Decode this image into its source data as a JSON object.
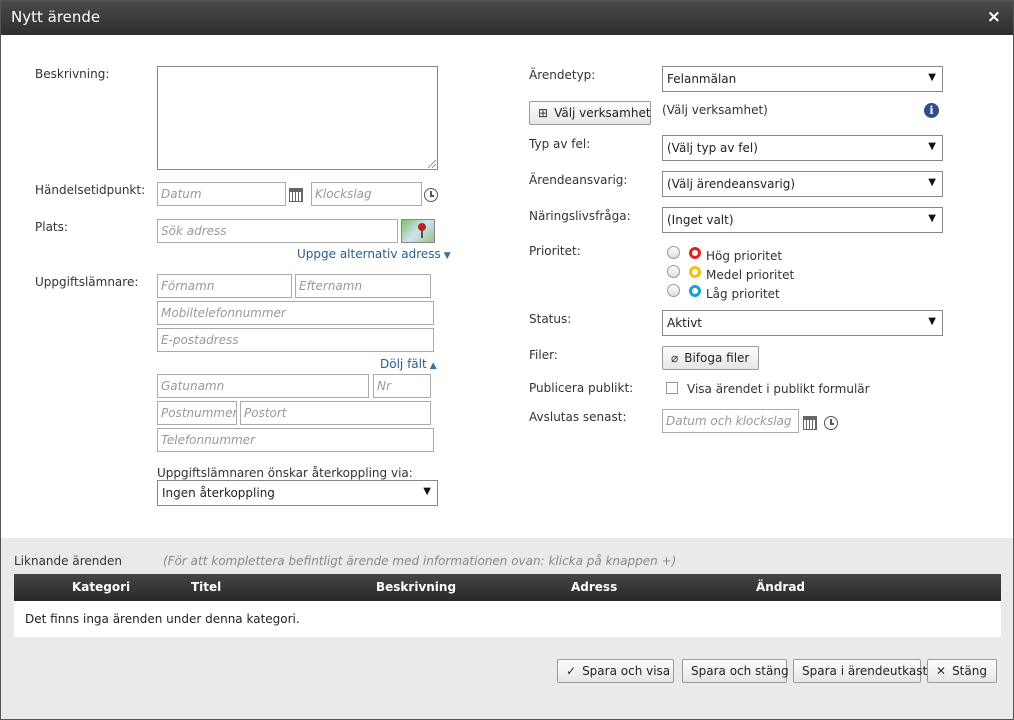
{
  "dialog": {
    "title": "Nytt ärende",
    "close_symbol": "×"
  },
  "left": {
    "description_label": "Beskrivning:",
    "event_time_label": "Händelsetidpunkt:",
    "date_placeholder": "Datum",
    "time_placeholder": "Klockslag",
    "place_label": "Plats:",
    "address_placeholder": "Sök adress",
    "alt_address_link": "Uppge alternativ adress",
    "informant_label": "Uppgiftslämnare:",
    "first_name_placeholder": "Förnamn",
    "last_name_placeholder": "Efternamn",
    "mobile_placeholder": "Mobiltelefonnummer",
    "email_placeholder": "E-postadress",
    "hide_fields_link": "Dölj fält",
    "street_placeholder": "Gatunamn",
    "number_placeholder": "Nr",
    "postal_code_placeholder": "Postnummer",
    "postal_town_placeholder": "Postort",
    "phone_placeholder": "Telefonnummer",
    "feedback_label": "Uppgiftslämnaren önskar återkoppling via:",
    "feedback_value": "Ingen återkoppling"
  },
  "right": {
    "case_type_label": "Ärendetyp:",
    "case_type_value": "Felanmälan",
    "select_business_button": "Välj verksamhet",
    "select_business_value": "(Välj verksamhet)",
    "fault_type_label": "Typ av fel:",
    "fault_type_value": "(Välj typ av fel)",
    "responsible_label": "Ärendeansvarig:",
    "responsible_value": "(Välj ärendeansvarig)",
    "business_question_label": "Näringslivsfråga:",
    "business_question_value": "(Inget valt)",
    "priority_label": "Prioritet:",
    "priorities": [
      {
        "label": "Hög prioritet",
        "color": "#e02020"
      },
      {
        "label": "Medel prioritet",
        "color": "#f2c200"
      },
      {
        "label": "Låg prioritet",
        "color": "#1a9fd0"
      }
    ],
    "status_label": "Status:",
    "status_value": "Aktivt",
    "files_label": "Filer:",
    "attach_button": "Bifoga filer",
    "publish_label": "Publicera publikt:",
    "publish_checkbox_label": "Visa ärendet i publikt formulär",
    "deadline_label": "Avslutas senast:",
    "deadline_placeholder": "Datum och klockslag"
  },
  "similar": {
    "title": "Liknande ärenden",
    "hint": "(För att komplettera befintligt ärende med informationen ovan: klicka på knappen +)",
    "columns": [
      "Kategori",
      "Titel",
      "Beskrivning",
      "Adress",
      "Ändrad"
    ],
    "empty_message": "Det finns inga ärenden under denna kategori."
  },
  "footer": {
    "save_view": "Spara och visa",
    "save_close": "Spara och stäng",
    "save_draft": "Spara i ärendeutkast",
    "close": "Stäng"
  }
}
